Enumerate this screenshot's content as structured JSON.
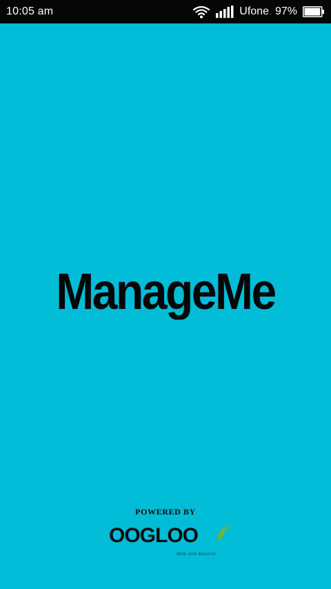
{
  "status_bar": {
    "time": "10:05 am",
    "carrier": "Ufone",
    "battery_percent": "97%",
    "battery_level": 0.97,
    "icons": [
      "wifi-icon",
      "signal-icon",
      "battery-icon"
    ]
  },
  "splash": {
    "app_name": "ManageMe",
    "powered_by": "POWERED BY",
    "brand_name": "OOGLOO",
    "brand_tagline": "Web and Beyond"
  },
  "colors": {
    "background": "#00bcd6",
    "status_bar": "#060606",
    "text_dark": "#060606",
    "logo_accent": "#6db33f"
  }
}
